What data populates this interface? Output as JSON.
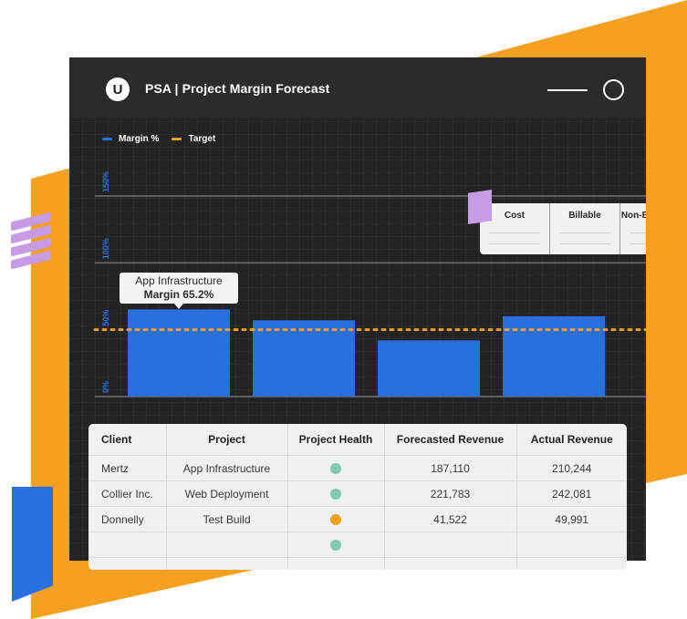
{
  "app": {
    "logo_letter": "U",
    "title": "PSA | Project Margin Forecast"
  },
  "colors": {
    "accent_blue": "#2a6fe0",
    "target_orange": "#f5a020",
    "health_green": "#7fc9ad",
    "health_orange": "#f5a020",
    "lavender": "#c79be6"
  },
  "legend": [
    {
      "label": "Margin %",
      "color": "#2a6fe0"
    },
    {
      "label": "Target",
      "color": "#f5a020"
    }
  ],
  "chart_data": {
    "type": "bar",
    "categories": [
      "App Infrastructure",
      "Web Deployment",
      "Test Build",
      ""
    ],
    "series": [
      {
        "name": "Margin %",
        "values": [
          65.2,
          57,
          42,
          60
        ]
      }
    ],
    "target": 50,
    "ylim": [
      0,
      150
    ],
    "yticks": [
      "0%",
      "50%",
      "100%",
      "150%"
    ],
    "ytick_values": [
      0,
      50,
      100,
      150
    ],
    "grid": true,
    "legend_position": "top-left"
  },
  "tooltip": {
    "title": "App Infrastructure",
    "value": "Margin 65.2%"
  },
  "cost_card": {
    "columns": [
      "Cost",
      "Billable",
      "Non-Billable"
    ]
  },
  "table": {
    "headers": [
      "Client",
      "Project",
      "Project Health",
      "Forecasted Revenue",
      "Actual Revenue"
    ],
    "rows": [
      {
        "client": "Mertz",
        "project": "App Infrastructure",
        "health": "green",
        "forecasted": "187,110",
        "actual": "210,244"
      },
      {
        "client": "Collier Inc.",
        "project": "Web Deployment",
        "health": "green",
        "forecasted": "221,783",
        "actual": "242,081"
      },
      {
        "client": "Donnelly",
        "project": "Test Build",
        "health": "orange",
        "forecasted": "41,522",
        "actual": "49,991"
      },
      {
        "client": "",
        "project": "",
        "health": "green",
        "forecasted": "",
        "actual": ""
      },
      {
        "client": "",
        "project": "",
        "health": "",
        "forecasted": "",
        "actual": ""
      }
    ]
  }
}
